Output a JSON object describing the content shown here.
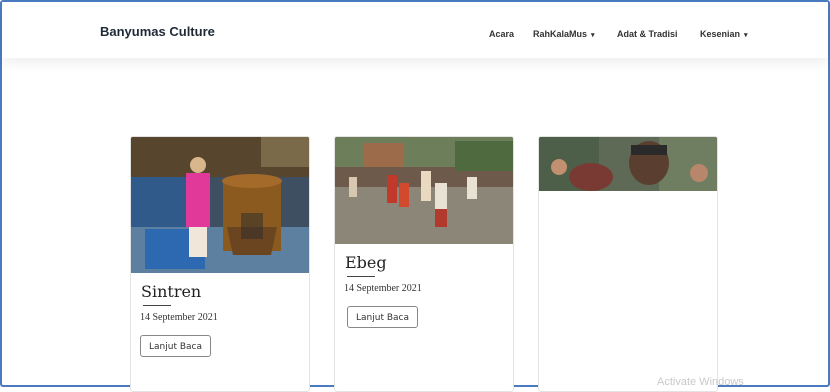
{
  "brand": {
    "title": "Banyumas Culture"
  },
  "nav": {
    "items": [
      {
        "label": "Acara",
        "has_caret": false
      },
      {
        "label": "RahKalaMus",
        "has_caret": true
      },
      {
        "label": "Adat & Tradisi",
        "has_caret": false
      },
      {
        "label": "Kesenian",
        "has_caret": true
      }
    ],
    "caret": "▾"
  },
  "cards": [
    {
      "title": "Sintren",
      "date": "14 September 2021",
      "button_label": "Lanjut Baca"
    },
    {
      "title": "Ebeg",
      "date": "14 September 2021",
      "button_label": "Lanjut Baca"
    },
    {
      "title": "",
      "date": "",
      "button_label": ""
    }
  ],
  "watermark": "Activate Windows",
  "colors": {
    "frame_border": "#4a7ac0",
    "brand_text": "#1f2a36"
  }
}
